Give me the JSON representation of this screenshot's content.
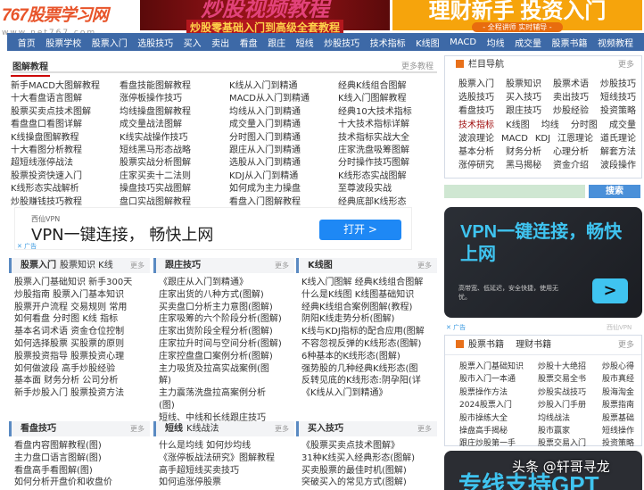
{
  "header": {
    "logo": "767股票学习网",
    "url": "www.net767.com",
    "banner1": {
      "title": "炒股视频教程",
      "sub": "炒股零基础入门到高级全套教程"
    },
    "banner2": {
      "title": "理财新手 投资入门",
      "sub": "- 全程讲师 实时辅导 -"
    }
  },
  "nav": [
    "首页",
    "股票学校",
    "股票入门",
    "选股技巧",
    "买入",
    "卖出",
    "看盘",
    "跟庄",
    "短线",
    "炒股技巧",
    "技术指标",
    "K线图",
    "MACD",
    "均线",
    "成交量",
    "股票书籍",
    "视频教程"
  ],
  "tutorials": {
    "title": "图解教程",
    "more": "更多教程",
    "columns": [
      [
        "新手MACD大图解教程",
        "十大看盘语言图解",
        "股票买卖点技术图解",
        "看盘盘口看图详解",
        "K线操盘图解教程",
        "十大看图分析教程",
        "超短线涨停战法",
        "股票投资快速入门",
        "K线形态实战解析",
        "炒股赚钱技巧教程"
      ],
      [
        "看盘技能图解教程",
        "涨停板操作技巧",
        "均线操盘图解教程",
        "成交量战法图解",
        "K线实战操作技巧",
        "短线黑马形态战略",
        "股票实战分析图解",
        "庄家买卖十二法则",
        "操盘技巧实战图解",
        "盘口实战图解教程"
      ],
      [
        "K线从入门到精通",
        "MACD从入门到精通",
        "均线从入门到精通",
        "成交量入门到精通",
        "分时图入门到精通",
        "跟庄从入门到精通",
        "选股从入门到精通",
        "KDJ从入门到精通",
        "如何成为主力操盘",
        "看盘入门图解教程"
      ],
      [
        "经典K线组合图解",
        "K线入门图解教程",
        "经典10大技术指标",
        "十大技术指标详解",
        "技术指标实战大全",
        "庄家洗盘吸筹图解",
        "分时操作技巧图解",
        "K线形态实战图解",
        "至尊波段实战",
        "经典底部K线形态"
      ]
    ]
  },
  "ad_main": {
    "sponsor": "西仙VPN",
    "headline": "VPN一键连接， 畅快上网",
    "button": "打开 >",
    "label": "✕ 广告"
  },
  "boxes": [
    {
      "title": "股票入门",
      "sub": "股票知识 K线",
      "more": "更多",
      "items": [
        "股票入门基础知识 新手300天",
        "炒股指南 股票入门基本知识",
        "股票开户流程  交易规则 常用",
        "如何看盘 分时图  K线 指标",
        "基本名词术语 资金仓位控制",
        "如何选择股票 买股票的原则",
        "股票投资指导 股票投资心理",
        "如何做波段   高手炒股经验",
        "基本面   财务分析 公司分析",
        "新手炒股入门  股票投资方法"
      ]
    },
    {
      "title": "跟庄技巧",
      "sub": "",
      "more": "更多",
      "items": [
        "《跟庄从入门到精通》",
        "庄家出货的八种方式(图解)",
        "买卖盘口分析主力意图(图解)",
        "庄家吸筹的六个阶段分析(图解)",
        "庄家出货阶段全程分析(图解)",
        "庄家拉升时间与空间分析(图解)",
        "庄家控盘盘口案例分析(图解)",
        "主力吸货及拉高实战案例(图",
        "解)",
        "主力震荡洗盘拉高案例分析",
        "(图)",
        "短线、中线和长线跟庄技巧"
      ]
    },
    {
      "title": "K线图",
      "sub": "",
      "more": "更多",
      "items": [
        "K线入门图解 经典K线组合图解",
        "什么是K线图  K线图基础知识",
        "经典K线组合案例图解(教程)",
        "阴阳K线走势分析(图解)",
        "K线与KDJ指标的配合应用(图解",
        "不容忽视反弹的K线形态(图解)",
        "6种基本的K线形态(图解)",
        "强势股的几种经典K线形态(图",
        "反转见底的K线形态:阴孕阳(详",
        "《K线从入门到精通》"
      ]
    },
    {
      "title": "看盘技巧",
      "sub": "",
      "more": "更多",
      "items": [
        "看盘内容图解教程(图)",
        "主力盘口语言图解(图)",
        "看盘高手看图解(图)",
        "如何分析开盘价和收盘价"
      ]
    },
    {
      "title": "短线",
      "sub": "K线战法",
      "more": "更多",
      "items": [
        "什么是均线 如何炒均线",
        "《涨停板战法研究》图解教程",
        "高手超短线买卖技巧",
        "如何追涨停股票"
      ]
    },
    {
      "title": "买入技巧",
      "sub": "",
      "more": "更多",
      "items": [
        "《股票买卖点技术图解》",
        "31种K线买入经典形态(图解)",
        "买卖股票的最佳时机(图解)",
        "突破买入的常见方式(图解)"
      ]
    }
  ],
  "sidebar": {
    "nav_title": "栏目导航",
    "nav_more": "更多",
    "nav_rows": [
      [
        "股票入门",
        "股票知识",
        "股票术语",
        "炒股技巧"
      ],
      [
        "选股技巧",
        "买入技巧",
        "卖出技巧",
        "短线技巧"
      ],
      [
        "看盘技巧",
        "跟庄技巧",
        "炒股经验",
        "投资策略"
      ],
      [
        "技术指标",
        "K线图",
        "均线",
        "分时图",
        "成交量"
      ],
      [
        "波浪理论",
        "MACD",
        "KDJ",
        "江恩理论",
        "道氏理论"
      ],
      [
        "基本分析",
        "财务分析",
        "心理分析",
        "解套方法"
      ],
      [
        "涨停研究",
        "黑马揭秘",
        "资金介绍",
        "波段操作"
      ]
    ],
    "highlight_color": "#a01010",
    "search_button": "搜索",
    "ad": {
      "headline": "VPN一键连接，畅快上网",
      "desc": "高带宽、低延迟，安全快捷，使用无忧。",
      "label": "✕ 广告",
      "brand": "西仙VPN"
    },
    "books": {
      "tab1": "股票书籍",
      "tab2": "理财书籍",
      "more": "更多",
      "items": [
        "股票入门基础知识",
        "炒股十大绝招",
        "炒股心得",
        "股市入门一本通",
        "股票交易全书",
        "股市真经",
        "股票操作方法",
        "炒股实战技巧",
        "股海淘金",
        "2024股票入门",
        "炒股入门手册",
        "股票指南",
        "股市操练大全",
        "均线战法",
        "股票基础",
        "操盘高手揭秘",
        "股市赢家",
        "短线操作",
        "跟庄炒股第一手",
        "股票交易入门",
        "投资策略"
      ]
    },
    "ad2": "专线支持GPT"
  },
  "watermark": "头条 @轩哥寻龙"
}
